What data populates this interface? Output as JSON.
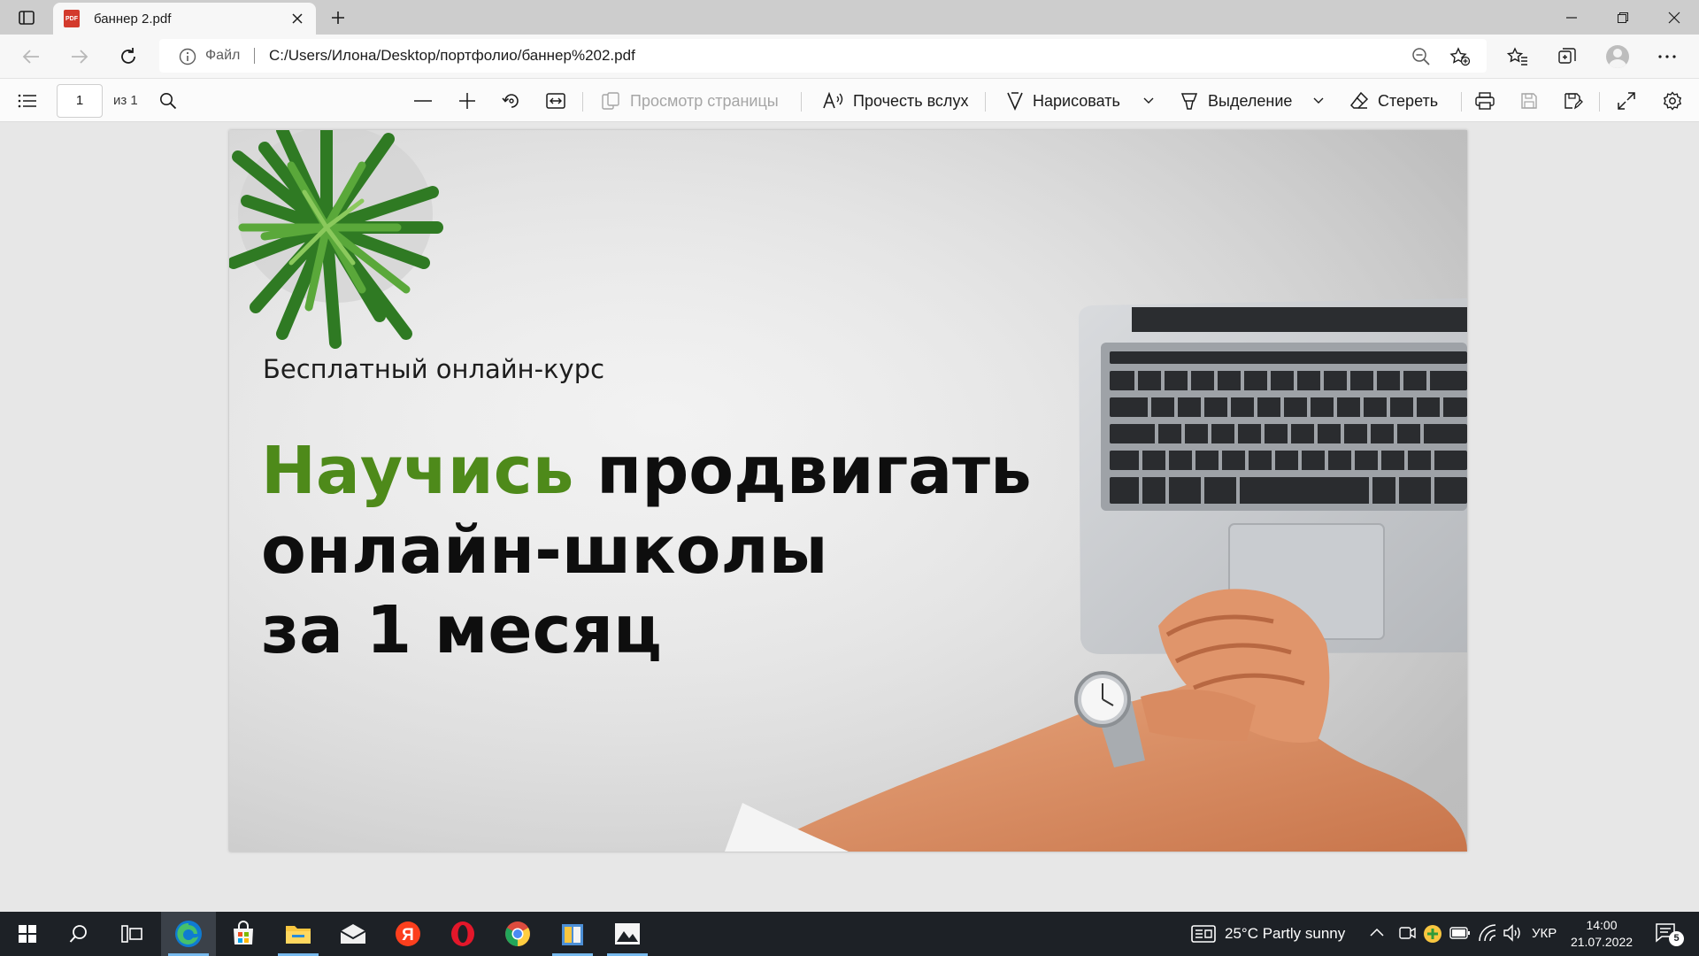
{
  "tab": {
    "title": "баннер 2.pdf",
    "pdf_badge": "PDF"
  },
  "address": {
    "scheme_label": "Файл",
    "url": "C:/Users/Илона/Desktop/портфолио/баннер%202.pdf"
  },
  "pdf_toolbar": {
    "page_number": "1",
    "page_count": "из 1",
    "page_view_label": "Просмотр страницы",
    "read_aloud_label": "Прочесть вслух",
    "draw_label": "Нарисовать",
    "highlight_label": "Выделение",
    "erase_label": "Стереть"
  },
  "banner": {
    "subtitle": "Бесплатный онлайн-курс",
    "headline_accent": "Научись",
    "headline_rest1": " продвигать",
    "headline_line2": "онлайн-школы",
    "headline_line3": "за 1 месяц"
  },
  "taskbar": {
    "weather": "25°C  Partly sunny",
    "language": "УКР",
    "time": "14:00",
    "date": "21.07.2022",
    "notifications": "5",
    "yandex_letter": "Я"
  },
  "colors": {
    "accent_green": "#4e8a1a",
    "taskbar": "#1d2126",
    "edge_blue": "#0f7bd1"
  }
}
